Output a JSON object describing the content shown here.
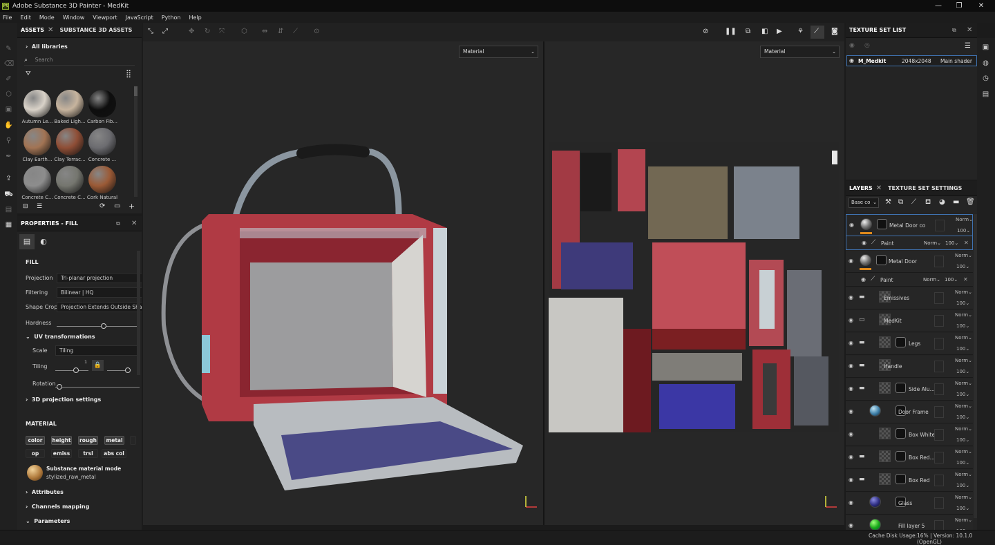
{
  "window": {
    "title": "Adobe Substance 3D Painter - MedKit",
    "logo": "Pt"
  },
  "menu": [
    "File",
    "Edit",
    "Mode",
    "Window",
    "Viewport",
    "JavaScript",
    "Python",
    "Help"
  ],
  "assets": {
    "tabs": [
      "ASSETS",
      "SUBSTANCE 3D ASSETS"
    ],
    "library": "All libraries",
    "search_placeholder": "Search",
    "materials": [
      {
        "name": "Autumn Le...",
        "color": "#d9d2c8"
      },
      {
        "name": "Baked Ligh...",
        "color": "#c7b49e"
      },
      {
        "name": "Carbon Fib...",
        "color": "#0e0e0e"
      },
      {
        "name": "Clay Earth...",
        "color": "#a27454"
      },
      {
        "name": "Clay Terrac...",
        "color": "#8f4e36"
      },
      {
        "name": "Concrete ...",
        "color": "#6c6c70"
      },
      {
        "name": "Concrete C...",
        "color": "#8d8d8d"
      },
      {
        "name": "Concrete C...",
        "color": "#75766f"
      },
      {
        "name": "Cork Natural",
        "color": "#9b5a36"
      }
    ]
  },
  "properties": {
    "title": "PROPERTIES - FILL",
    "section_fill": "FILL",
    "projection_label": "Projection",
    "projection_value": "Tri-planar projection",
    "filtering_label": "Filtering",
    "filtering_value": "Bilinear | HQ",
    "shapecrop_label": "Shape Crop",
    "shapecrop_value": "Projection Extends Outside Shape",
    "hardness_label": "Hardness",
    "uv_label": "UV transformations",
    "scale_label": "Scale",
    "scale_value": "Tiling",
    "tiling_label": "Tiling",
    "tiling_value": "1",
    "rotation_label": "Rotation",
    "proj3d_label": "3D projection settings",
    "section_material": "MATERIAL",
    "channels_row1": [
      "color",
      "height",
      "rough",
      "metal"
    ],
    "channels_row2": [
      "op",
      "emiss",
      "trsl",
      "abs col"
    ],
    "material_mode_title": "Substance material mode",
    "material_mode_value": "stylized_raw_metal",
    "attributes_label": "Attributes",
    "channels_mapping_label": "Channels mapping",
    "parameters_label": "Parameters"
  },
  "viewport": {
    "left_mode": "Material",
    "right_mode": "Material"
  },
  "texture_set_list": {
    "title": "TEXTURE SET LIST",
    "item_name": "M_Medkit",
    "item_res": "2048x2048",
    "item_shader": "Main shader"
  },
  "layers": {
    "tabs": [
      "LAYERS",
      "TEXTURE SET SETTINGS"
    ],
    "channel": "Base co",
    "paint_label": "Paint",
    "blend": "Norm",
    "opacity": "100",
    "items": [
      {
        "name": "Metal Door copy...",
        "kind": "mat",
        "sub": true,
        "selected": true
      },
      {
        "name": "Metal Door",
        "kind": "mat",
        "sub": true
      },
      {
        "name": "Emissives",
        "kind": "folder"
      },
      {
        "name": "MedKit",
        "kind": "folder-open"
      },
      {
        "name": "Legs",
        "kind": "folder-mask"
      },
      {
        "name": "Handle",
        "kind": "folder"
      },
      {
        "name": "Side Alu...",
        "kind": "folder-mask"
      },
      {
        "name": "Door Frame",
        "kind": "blue-mask"
      },
      {
        "name": "Box White",
        "kind": "gray-mask"
      },
      {
        "name": "Box Red...",
        "kind": "folder-mask"
      },
      {
        "name": "Box Red",
        "kind": "folder-mask"
      },
      {
        "name": "Glass",
        "kind": "glass-mask"
      },
      {
        "name": "Fill layer 5",
        "kind": "green"
      }
    ]
  },
  "status": {
    "cache": "Cache Disk Usage:",
    "info": "16% | Version: 10.1.0 (OpenGL)"
  }
}
